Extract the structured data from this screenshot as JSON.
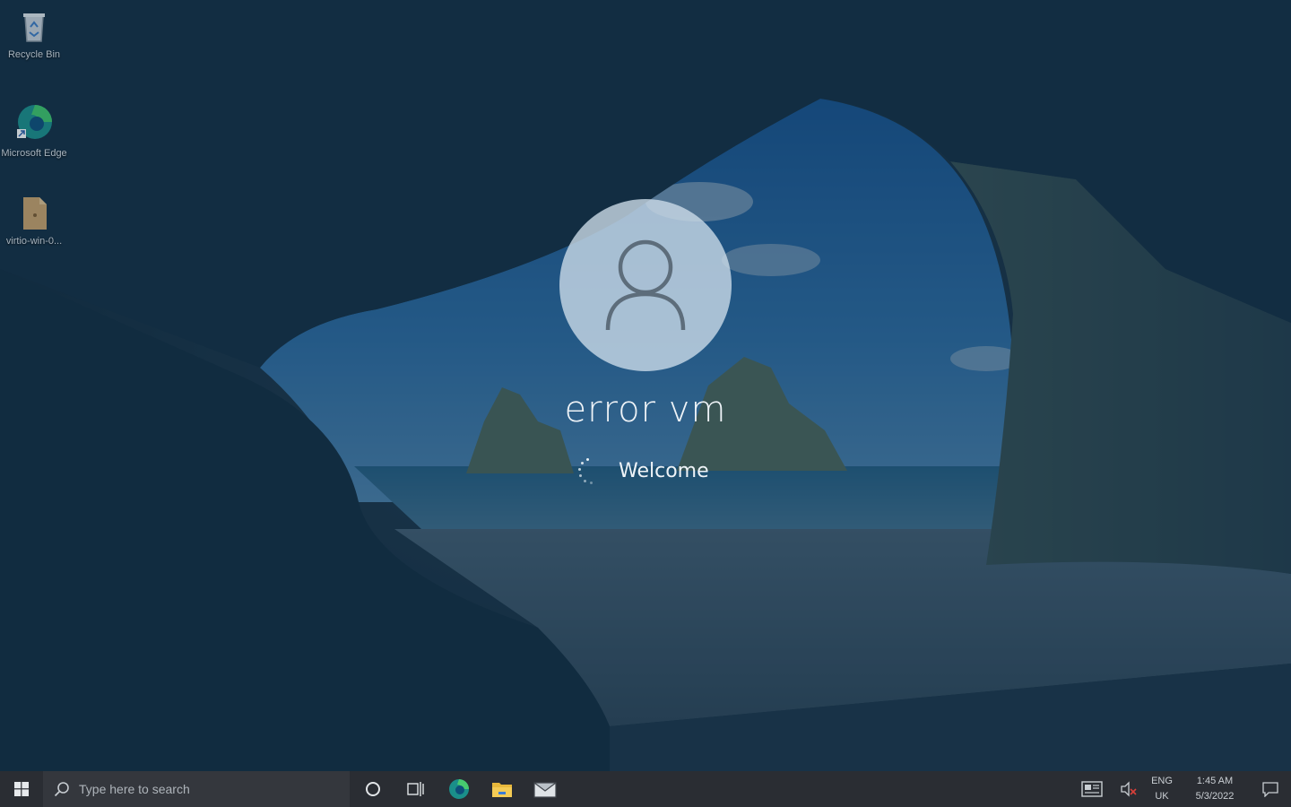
{
  "desktop": {
    "icons": [
      {
        "label": "Recycle Bin",
        "icon": "recycle-bin-icon"
      },
      {
        "label": "Microsoft Edge",
        "icon": "edge-icon"
      },
      {
        "label": "virtio-win-0...",
        "icon": "file-icon"
      }
    ]
  },
  "login": {
    "username": "error vm",
    "status": "Welcome",
    "avatar_icon": "user-icon"
  },
  "taskbar": {
    "start_icon": "windows-logo-icon",
    "search_placeholder": "Type here to search",
    "pinned": [
      {
        "name": "cortana",
        "icon": "cortana-circle-icon"
      },
      {
        "name": "task-view",
        "icon": "task-view-icon"
      },
      {
        "name": "edge",
        "icon": "edge-icon"
      },
      {
        "name": "file-explorer",
        "icon": "folder-icon"
      },
      {
        "name": "mail",
        "icon": "mail-icon"
      }
    ],
    "tray": {
      "lang_line1": "ENG",
      "lang_line2": "UK",
      "time": "1:45 AM",
      "date": "5/3/2022",
      "volume_state": "muted"
    }
  },
  "colors": {
    "taskbar": "#2a2d33",
    "overlay": "#103452",
    "text": "#eef3f7"
  }
}
